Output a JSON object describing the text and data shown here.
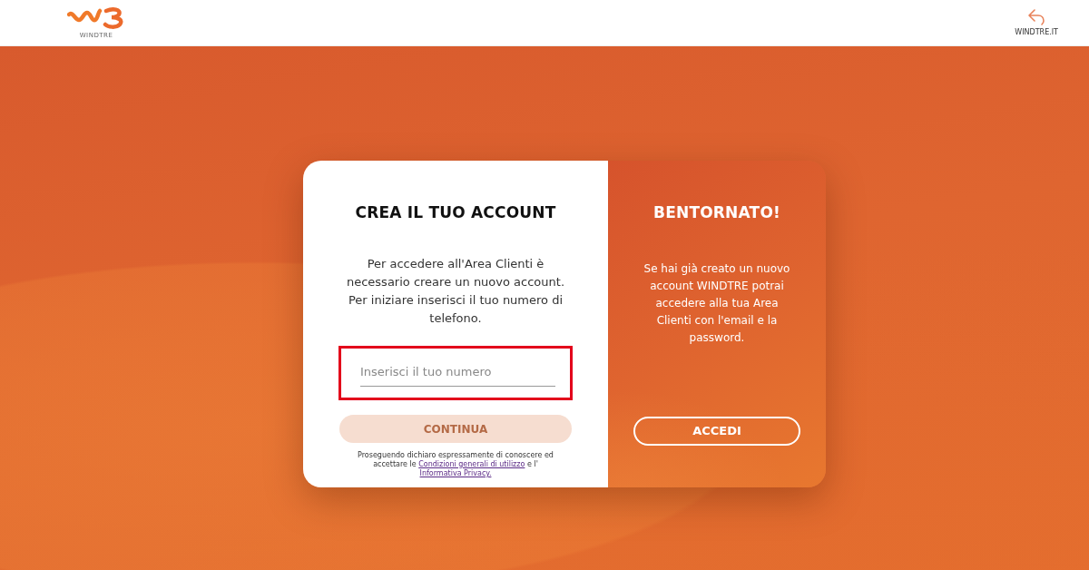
{
  "header": {
    "logo_text": "WINDTRE",
    "site_link": {
      "label": "WINDTRE.IT"
    }
  },
  "signup": {
    "title": "CREA IL TUO ACCOUNT",
    "description": "Per accedere all'Area Clienti è necessario creare un nuovo account. Per iniziare inserisci il tuo numero di telefono.",
    "phone_field": {
      "placeholder": "Inserisci il tuo numero",
      "highlighted": true
    },
    "continue_button": {
      "label": "CONTINUA",
      "disabled": true
    },
    "legal": [
      {
        "kind": "text",
        "text": "Proseguendo dichiaro espressamente di conoscere ed accettare le "
      },
      {
        "kind": "link",
        "text": "Condizioni generali di utilizzo"
      },
      {
        "kind": "text",
        "text": " e l' "
      },
      {
        "kind": "link",
        "text": "Informativa Privacy."
      }
    ]
  },
  "login": {
    "title": "BENTORNATO!",
    "description": "Se hai già creato un nuovo account WINDTRE potrai accedere alla tua Area Clienti con l'email e la password.",
    "button": {
      "label": "ACCEDI"
    }
  }
}
